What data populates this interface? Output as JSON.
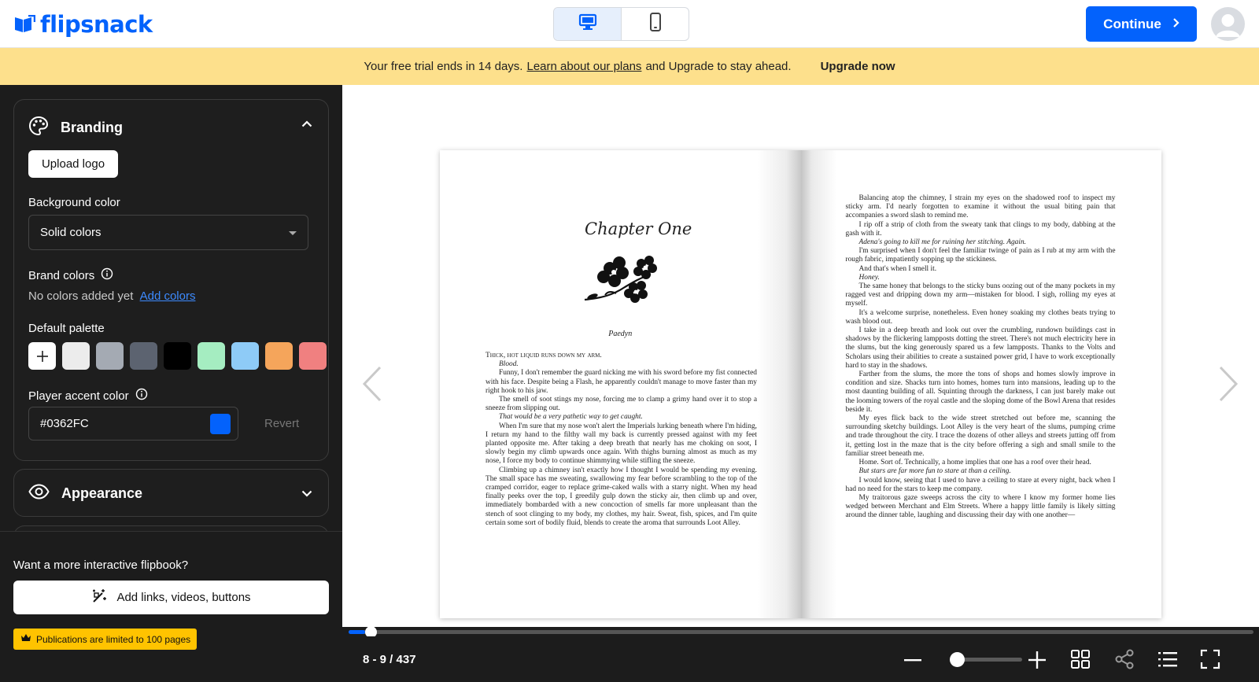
{
  "app": {
    "brand": "flipsnack"
  },
  "header": {
    "device_options": [
      {
        "name": "desktop",
        "icon": "desktop-icon",
        "active": true
      },
      {
        "name": "mobile",
        "icon": "mobile-icon",
        "active": false
      }
    ],
    "continue_label": "Continue",
    "accent_color": "#0362FC"
  },
  "banner": {
    "text_before": "Your free trial ends in 14 days.",
    "link_label": "Learn about our plans",
    "text_after": "and Upgrade to stay ahead.",
    "upgrade_label": "Upgrade now",
    "background": "#FDE08C"
  },
  "sidebar": {
    "branding": {
      "title": "Branding",
      "upload_logo_label": "Upload logo",
      "background_color_label": "Background color",
      "background_color_value": "Solid colors",
      "brand_colors_label": "Brand colors",
      "brand_colors_empty": "No colors added yet",
      "add_colors_label": "Add colors",
      "default_palette_label": "Default palette",
      "palette": [
        "#ececec",
        "#a4aab3",
        "#5c6370",
        "#000000",
        "#a5edc1",
        "#8ecbf7",
        "#f5a55b",
        "#f08080"
      ],
      "accent_label": "Player accent color",
      "accent_value": "#0362FC",
      "revert_label": "Revert"
    },
    "appearance": {
      "title": "Appearance"
    },
    "footer": {
      "question": "Want a more interactive flipbook?",
      "add_links_label": "Add links, videos, buttons",
      "limit_label": "Publications are limited to 100 pages"
    }
  },
  "book": {
    "chapter_title": "Chapter One",
    "author": "Paedyn",
    "left_opening": "Thick, hot liquid runs down my arm.",
    "left_paragraphs": [
      {
        "text": "Blood.",
        "italic": true
      },
      {
        "text": "Funny, I don't remember the guard nicking me with his sword before my fist connected with his face. Despite being a Flash, he apparently couldn't manage to move faster than my right hook to his jaw.",
        "italic": false
      },
      {
        "text": "The smell of soot stings my nose, forcing me to clamp a grimy hand over it to stop a sneeze from slipping out.",
        "italic": false
      },
      {
        "text": "That would be a very pathetic way to get caught.",
        "italic": true
      },
      {
        "text": "When I'm sure that my nose won't alert the Imperials lurking beneath where I'm hiding, I return my hand to the filthy wall my back is currently pressed against with my feet planted opposite me. After taking a deep breath that nearly has me choking on soot, I slowly begin my climb upwards once again. With thighs burning almost as much as my nose, I force my body to continue shimmying while stifling the sneeze.",
        "italic": false
      },
      {
        "text": "Climbing up a chimney isn't exactly how I thought I would be spending my evening. The small space has me sweating, swallowing my fear before scrambling to the top of the cramped corridor, eager to replace grime-caked walls with a starry night. When my head finally peeks over the top, I greedily gulp down the sticky air, then climb up and over, immediately bombarded with a new concoction of smells far more unpleasant than the stench of soot clinging to my body, my clothes, my hair. Sweat, fish, spices, and I'm quite certain some sort of bodily fluid, blends to create the aroma that surrounds Loot Alley.",
        "italic": false
      }
    ],
    "right_paragraphs": [
      {
        "text": "Balancing atop the chimney, I strain my eyes on the shadowed roof to inspect my sticky arm. I'd nearly forgotten to examine it without the usual biting pain that accompanies a sword slash to remind me.",
        "italic": false
      },
      {
        "text": "I rip off a strip of cloth from the sweaty tank that clings to my body, dabbing at the gash with it.",
        "italic": false
      },
      {
        "text": "Adena's going to kill me for ruining her stitching. Again.",
        "italic": true
      },
      {
        "text": "I'm surprised when I don't feel the familiar twinge of pain as I rub at my arm with the rough fabric, impatiently sopping up the stickiness.",
        "italic": false
      },
      {
        "text": "And that's when I smell it.",
        "italic": false
      },
      {
        "text": "Honey.",
        "italic": true
      },
      {
        "text": "The same honey that belongs to the sticky buns oozing out of the many pockets in my ragged vest and dripping down my arm—mistaken for blood. I sigh, rolling my eyes at myself.",
        "italic": false
      },
      {
        "text": "It's a welcome surprise, nonetheless. Even honey soaking my clothes beats trying to wash blood out.",
        "italic": false
      },
      {
        "text": "I take in a deep breath and look out over the crumbling, rundown buildings cast in shadows by the flickering lampposts dotting the street. There's not much electricity here in the slums, but the king generously spared us a few lampposts. Thanks to the Volts and Scholars using their abilities to create a sustained power grid, I have to work exceptionally hard to stay in the shadows.",
        "italic": false
      },
      {
        "text": "Farther from the slums, the more the tons of shops and homes slowly improve in condition and size. Shacks turn into homes, homes turn into mansions, leading up to the most daunting building of all. Squinting through the darkness, I can just barely make out the looming towers of the royal castle and the sloping dome of the Bowl Arena that resides beside it.",
        "italic": false
      },
      {
        "text": "My eyes flick back to the wide street stretched out before me, scanning the surrounding sketchy buildings. Loot Alley is the very heart of the slums, pumping crime and trade throughout the city. I trace the dozens of other alleys and streets jutting off from it, getting lost in the maze that is the city before offering a sigh and small smile to the familiar street beneath me.",
        "italic": false
      },
      {
        "text": "Home. Sort of. Technically, a home implies that one has a roof over their head.",
        "italic": false
      },
      {
        "text": "But stars are far more fun to stare at than a ceiling.",
        "italic": true
      },
      {
        "text": "I would know, seeing that I used to have a ceiling to stare at every night, back when I had no need for the stars to keep me company.",
        "italic": false
      },
      {
        "text": "My traitorous gaze sweeps across the city to where I know my former home lies wedged between Merchant and Elm Streets. Where a happy little family is likely sitting around the dinner table, laughing and discussing their day with one another—",
        "italic": false
      }
    ]
  },
  "player": {
    "page_count": "8 - 9 / 437",
    "progress": 0.018,
    "zoom_level": 0.0,
    "controls": [
      "zoom-out-icon",
      "zoom-in-icon",
      "grid-icon",
      "share-icon",
      "toc-icon",
      "fullscreen-icon"
    ]
  }
}
